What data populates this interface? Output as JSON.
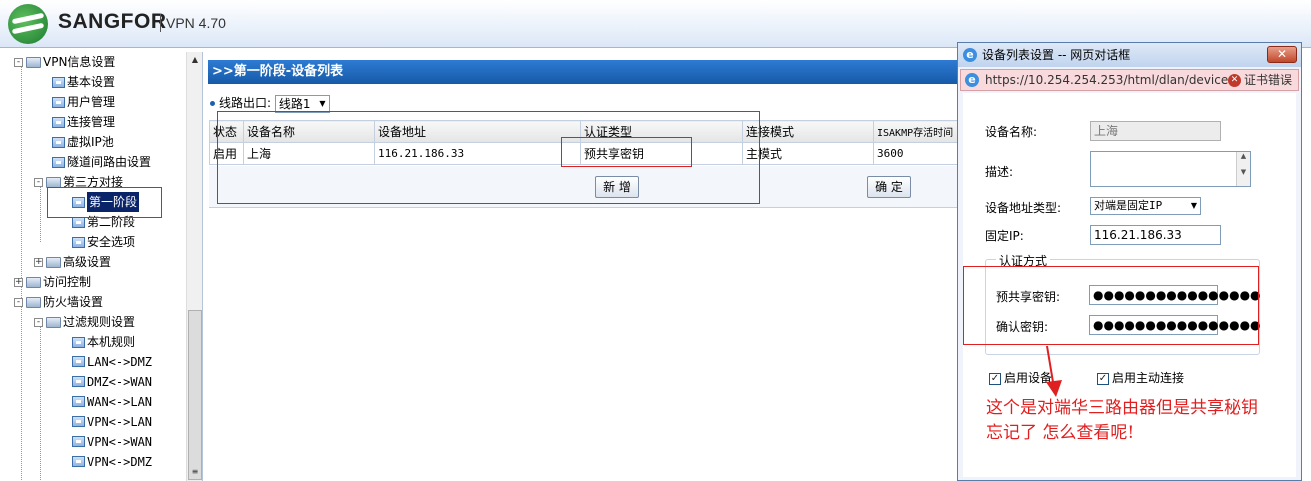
{
  "app": {
    "brand": "SANGFOR",
    "version": "VPN 4.70"
  },
  "tree": {
    "items": [
      {
        "label": "VPN信息设置",
        "type": "folder",
        "exp": "-"
      },
      {
        "label": "基本设置",
        "type": "page"
      },
      {
        "label": "用户管理",
        "type": "page"
      },
      {
        "label": "连接管理",
        "type": "page"
      },
      {
        "label": "虚拟IP池",
        "type": "page"
      },
      {
        "label": "隧道间路由设置",
        "type": "page"
      },
      {
        "label": "第三方对接",
        "type": "folder",
        "exp": "-"
      },
      {
        "label": "第一阶段",
        "type": "page",
        "selected": true
      },
      {
        "label": "第二阶段",
        "type": "page"
      },
      {
        "label": "安全选项",
        "type": "page"
      },
      {
        "label": "高级设置",
        "type": "folder",
        "exp": "+"
      },
      {
        "label": "访问控制",
        "type": "folder",
        "exp": "+"
      },
      {
        "label": "防火墙设置",
        "type": "folder",
        "exp": "-"
      },
      {
        "label": "过滤规则设置",
        "type": "folder",
        "exp": "-"
      },
      {
        "label": "本机规则",
        "type": "page"
      },
      {
        "label": "LAN<->DMZ",
        "type": "page"
      },
      {
        "label": "DMZ<->WAN",
        "type": "page"
      },
      {
        "label": "WAN<->LAN",
        "type": "page"
      },
      {
        "label": "VPN<->LAN",
        "type": "page"
      },
      {
        "label": "VPN<->WAN",
        "type": "page"
      },
      {
        "label": "VPN<->DMZ",
        "type": "page"
      }
    ]
  },
  "main": {
    "title": ">>第一阶段-设备列表",
    "line_label": "线路出口:",
    "line_value": "线路1",
    "columns": [
      "状态",
      "设备名称",
      "设备地址",
      "认证类型",
      "连接模式",
      "ISAKMP存活时间"
    ],
    "rows": [
      [
        "启用",
        "上海",
        "116.21.186.33",
        "预共享密钥",
        "主模式",
        "3600"
      ]
    ],
    "add_button": "新 增",
    "ok_button": "确 定"
  },
  "dialog": {
    "title": "设备列表设置 -- 网页对话框",
    "close": "✕",
    "url": "https://10.254.254.253/html/dlan/device",
    "cert_error": "证书错误",
    "device_name_label": "设备名称:",
    "device_name_value": "上海",
    "desc_label": "描述:",
    "addr_type_label": "设备地址类型:",
    "addr_type_value": "对端是固定IP",
    "fixed_ip_label": "固定IP:",
    "fixed_ip_value": "116.21.186.33",
    "auth_legend": "认证方式",
    "psk_label": "预共享密钥:",
    "psk_value": "●●●●●●●●●●●●●●●●",
    "confirm_label": "确认密钥:",
    "confirm_value": "●●●●●●●●●●●●●●●●",
    "enable_device": "启用设备",
    "active_connect": "启用主动连接"
  },
  "annotation": {
    "line1": "这个是对端华三路由器但是共享秘钥",
    "line2": "忘记了  怎么查看呢!"
  },
  "colors": {
    "annotation_red": "#e02020",
    "title_blue": "#1f66bf"
  }
}
